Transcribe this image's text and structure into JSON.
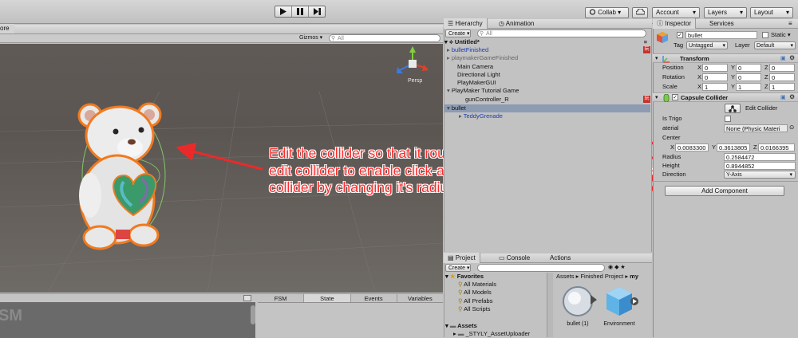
{
  "toolbar": {
    "collab": "Collab ▾",
    "account": "Account",
    "layers": "Layers",
    "layout": "Layout"
  },
  "scene": {
    "tab_fragment": "ore",
    "gizmos": "Gizmos",
    "search_placeholder": "All",
    "persp": "Persp"
  },
  "hierarchy": {
    "tab": "Hierarchy",
    "tab_animation": "Animation",
    "create": "Create",
    "search_placeholder": "All",
    "scene_name": "Untitled*",
    "items": [
      {
        "label": "bulletFinished",
        "style": "prefab-collapsed"
      },
      {
        "label": "playmakerGameFinished",
        "style": "gray-collapsed"
      },
      {
        "label": "Main Camera",
        "style": "plain"
      },
      {
        "label": "Directional Light",
        "style": "plain"
      },
      {
        "label": "PlayMakerGUI",
        "style": "plain"
      },
      {
        "label": "PlayMaker Tutorial Game",
        "style": "expanded"
      },
      {
        "label": "gunController_R",
        "style": "child"
      },
      {
        "label": "bullet",
        "style": "selected"
      },
      {
        "label": "TeddyGrenade",
        "style": "prefab-child"
      }
    ]
  },
  "inspector": {
    "tab": "Inspector",
    "tab_services": "Services",
    "object_name": "bullet",
    "static_label": "Static",
    "tag_label": "Tag",
    "tag_value": "Untagged",
    "layer_label": "Layer",
    "layer_value": "Default",
    "transform": {
      "title": "Transform",
      "rows": [
        {
          "label": "Position",
          "x": "0",
          "y": "0",
          "z": "0"
        },
        {
          "label": "Rotation",
          "x": "0",
          "y": "0",
          "z": "0"
        },
        {
          "label": "Scale",
          "x": "1",
          "y": "1",
          "z": "1"
        }
      ]
    },
    "collider": {
      "title": "Capsule Collider",
      "edit_label": "Edit Collider",
      "is_trigger_label": "Is Trigo",
      "material_label": "aterial",
      "material_value": "None (Physic Materi",
      "center_label": "Center",
      "center_x": "0.0083300",
      "center_y": "0.3613805",
      "center_z": "0.0166395",
      "radius_label": "Radius",
      "radius_value": "0.2584472",
      "height_label": "Height",
      "height_value": "0.8944852",
      "direction_label": "Direction",
      "direction_value": "Y-Axis"
    },
    "add_component": "Add Component"
  },
  "project": {
    "tab": "Project",
    "tab_console": "Console",
    "tab_actions": "Actions",
    "create": "Create",
    "favorites_label": "Favorites",
    "favorites": [
      "All Materials",
      "All Models",
      "All Prefabs",
      "All Scripts"
    ],
    "assets_label": "Assets",
    "assets_child": "_STYLY_AssetUploader",
    "breadcrumb": [
      "Assets",
      "Finished Project",
      "my"
    ],
    "assets": [
      "bullet (1)",
      "Environment"
    ]
  },
  "playmaker": {
    "tabs": [
      "FSM",
      "State",
      "Events",
      "Variables"
    ],
    "watermark": "SM"
  },
  "annotation": {
    "text": "Edit the collider so that it roughly encapsulates the bear. Click edit collider to enable click-and-drag editing, or manipulate the collider by changing it's radius and height"
  },
  "colors": {
    "scene_bg": "#5b5652",
    "panel_bg": "#c2c2c2",
    "selection": "#8d9bb3",
    "prefab_text": "#1a3aa8",
    "annotation_text": "#ff2a2a",
    "collider_outline": "#f07a20"
  }
}
